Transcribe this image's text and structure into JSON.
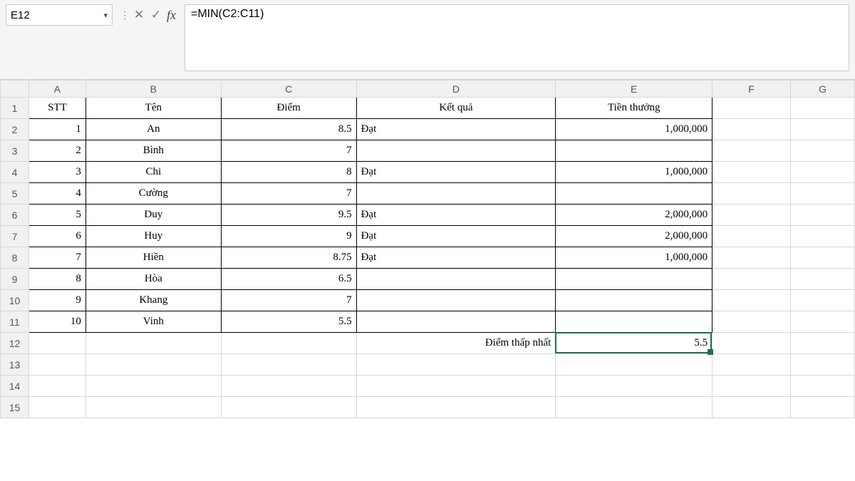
{
  "namebox": {
    "value": "E12"
  },
  "formula_bar": {
    "cancel_glyph": "✕",
    "accept_glyph": "✓",
    "fx_label": "fx",
    "formula": "=MIN(C2:C11)"
  },
  "columns": [
    "A",
    "B",
    "C",
    "D",
    "E",
    "F",
    "G"
  ],
  "row_numbers": [
    "1",
    "2",
    "3",
    "4",
    "5",
    "6",
    "7",
    "8",
    "9",
    "10",
    "11",
    "12",
    "13",
    "14",
    "15"
  ],
  "headers": {
    "A": "STT",
    "B": "Tên",
    "C": "Điểm",
    "D": "Kết quả",
    "E": "Tiền thưởng"
  },
  "rows": [
    {
      "stt": "1",
      "ten": "An",
      "diem": "8.5",
      "ketqua": "Đạt",
      "tien": "1,000,000"
    },
    {
      "stt": "2",
      "ten": "Bình",
      "diem": "7",
      "ketqua": "",
      "tien": ""
    },
    {
      "stt": "3",
      "ten": "Chi",
      "diem": "8",
      "ketqua": "Đạt",
      "tien": "1,000,000"
    },
    {
      "stt": "4",
      "ten": "Cường",
      "diem": "7",
      "ketqua": "",
      "tien": ""
    },
    {
      "stt": "5",
      "ten": "Duy",
      "diem": "9.5",
      "ketqua": "Đạt",
      "tien": "2,000,000"
    },
    {
      "stt": "6",
      "ten": "Huy",
      "diem": "9",
      "ketqua": "Đạt",
      "tien": "2,000,000"
    },
    {
      "stt": "7",
      "ten": "Hiền",
      "diem": "8.75",
      "ketqua": "Đạt",
      "tien": "1,000,000"
    },
    {
      "stt": "8",
      "ten": "Hòa",
      "diem": "6.5",
      "ketqua": "",
      "tien": ""
    },
    {
      "stt": "9",
      "ten": "Khang",
      "diem": "7",
      "ketqua": "",
      "tien": ""
    },
    {
      "stt": "10",
      "ten": "Vinh",
      "diem": "5.5",
      "ketqua": "",
      "tien": ""
    }
  ],
  "summary": {
    "label": "Điểm thấp nhất",
    "value": "5.5"
  },
  "selection": {
    "cell": "E12"
  }
}
